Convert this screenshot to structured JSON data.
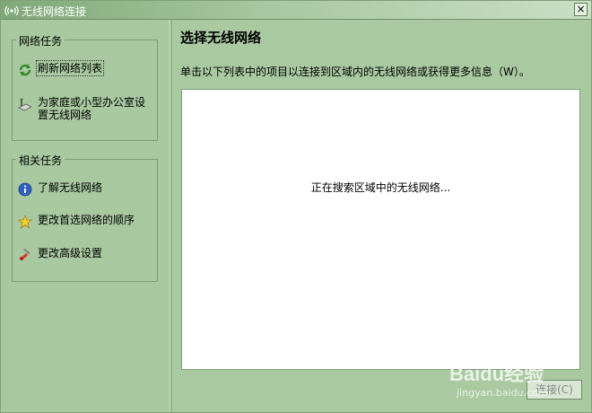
{
  "window": {
    "title": "无线网络连接",
    "close_label": "×"
  },
  "sidebar": {
    "network_tasks": {
      "label": "网络任务",
      "items": [
        {
          "label": "刷新网络列表",
          "icon": "refresh-icon"
        },
        {
          "label": "为家庭或小型办公室设置无线网络",
          "icon": "network-setup-icon"
        }
      ]
    },
    "related_tasks": {
      "label": "相关任务",
      "items": [
        {
          "label": "了解无线网络",
          "icon": "info-icon"
        },
        {
          "label": "更改首选网络的顺序",
          "icon": "star-icon"
        },
        {
          "label": "更改高级设置",
          "icon": "settings-icon"
        }
      ]
    }
  },
  "main": {
    "title": "选择无线网络",
    "instruction": "单击以下列表中的项目以连接到区域内的无线网络或获得更多信息（W）。",
    "list_status": "正在搜索区域中的无线网络...",
    "connect_label": "连接(C)"
  },
  "watermark": {
    "logo": "Baidu经验",
    "sub": "jingyan.baidu.com"
  },
  "colors": {
    "window_bg": "#a9c9a1",
    "list_bg": "#ffffff"
  }
}
